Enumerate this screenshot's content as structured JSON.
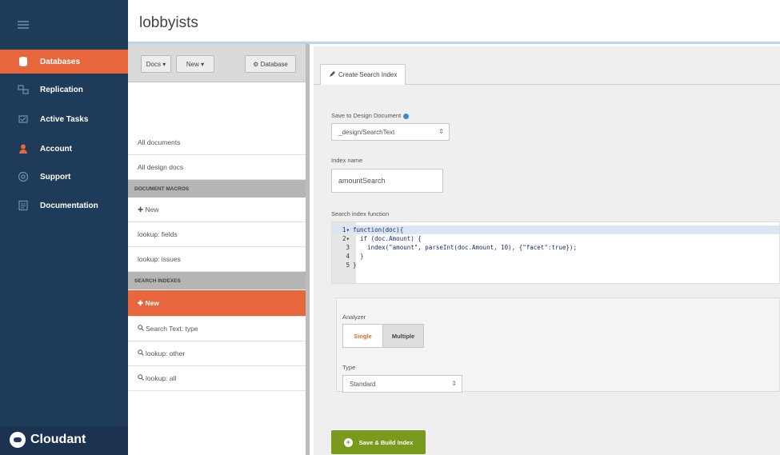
{
  "sidebar": {
    "items": [
      {
        "label": "Databases",
        "icon": "database-icon"
      },
      {
        "label": "Replication",
        "icon": "replication-icon"
      },
      {
        "label": "Active Tasks",
        "icon": "tasks-icon"
      },
      {
        "label": "Account",
        "icon": "account-icon"
      },
      {
        "label": "Support",
        "icon": "support-icon"
      },
      {
        "label": "Documentation",
        "icon": "documentation-icon"
      }
    ],
    "brand": "Cloudant"
  },
  "header": {
    "title": "lobbyists"
  },
  "toolbar": {
    "docs_label": "Docs ▾",
    "new_label": "New ▾",
    "database_label": "⚙ Database"
  },
  "list": {
    "all_documents": "All documents",
    "all_design_docs": "All design docs",
    "section_docs": "DOCUMENT MACROS",
    "new_doc": "✚ New",
    "fields": "lookup: fields",
    "issues": "lookup: issues",
    "section_search": "SEARCH INDEXES",
    "new_index": "✚ New",
    "search_type": "Search Text: type",
    "other": "lookup: other",
    "all": "lookup: all"
  },
  "tab": {
    "create_label": "Create Search Index"
  },
  "form": {
    "save_to_label": "Save to Design Document",
    "design_doc_value": "_design/SearchText",
    "index_name_label": "Index name",
    "index_name_value": "amountSearch",
    "search_fn_label": "Search index function",
    "analyzer_label": "Analyzer",
    "analyzer_single": "Single",
    "analyzer_multiple": "Multiple",
    "type_label": "Type",
    "type_value": "Standard",
    "save_button": "Save & Build Index"
  },
  "code": {
    "lines": [
      "function(doc){",
      "  if (doc.Amount) {",
      "    index(\"amount\", parseInt(doc.Amount, 10), {\"facet\":true});",
      "  }",
      "}"
    ]
  },
  "colors": {
    "accent": "#e8663b",
    "sidebar": "#1f3b5a",
    "save": "#7a9a1e"
  }
}
